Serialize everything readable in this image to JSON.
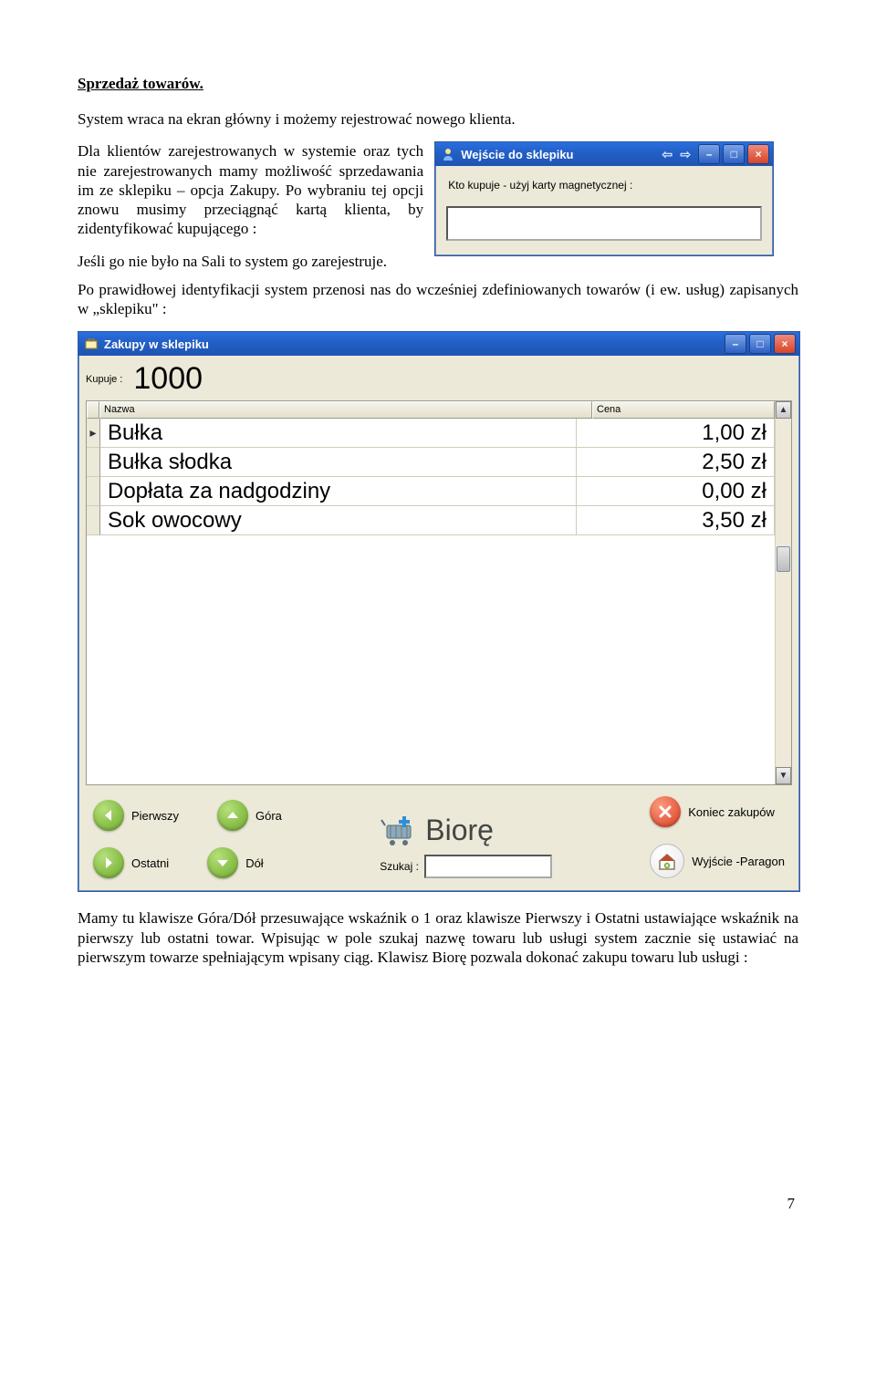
{
  "doc": {
    "heading": "Sprzedaż towarów.",
    "p1": "System wraca na ekran główny i możemy rejestrować nowego klienta.",
    "p2a": "Dla klientów zarejestrowanych w systemie oraz tych nie zarejestrowanych mamy możliwość sprzedawania im ze sklepiku – opcja Zakupy. Po wybraniu tej opcji znowu musimy przeciągnąć kartą klienta, by zidentyfikować kupującego :",
    "p2b": "Jeśli go nie było na Sali to system go zarejestruje.",
    "p3": "Po prawidłowej identyfikacji system przenosi nas do wcześniej zdefiniowanych towarów (i ew. usług) zapisanych w „sklepiku\" :",
    "p4": "Mamy tu klawisze Góra/Dół przesuwające wskaźnik o 1 oraz klawisze Pierwszy i Ostatni ustawiające wskaźnik na pierwszy lub ostatni towar. Wpisując w pole szukaj nazwę towaru lub usługi system zacznie się ustawiać na pierwszym towarze spełniającym wpisany ciąg. Klawisz Biorę pozwala dokonać zakupu towaru lub usługi :",
    "page_number": "7"
  },
  "dlg1": {
    "title": "Wejście do sklepiku",
    "label": "Kto kupuje - użyj karty magnetycznej :",
    "value": ""
  },
  "dlg2": {
    "title": "Zakupy w sklepiku",
    "buyer_label": "Kupuje :",
    "buyer_value": "1000",
    "col_name": "Nazwa",
    "col_price": "Cena",
    "rows": [
      {
        "name": "Bułka",
        "price": "1,00 zł"
      },
      {
        "name": "Bułka słodka",
        "price": "2,50 zł"
      },
      {
        "name": "Dopłata za nadgodziny",
        "price": "0,00 zł"
      },
      {
        "name": "Sok owocowy",
        "price": "3,50 zł"
      }
    ],
    "btn_first": "Pierwszy",
    "btn_last": "Ostatni",
    "btn_up": "Góra",
    "btn_down": "Dół",
    "btn_search_label": "Szukaj :",
    "btn_search_value": "",
    "btn_take": "Biorę",
    "btn_end": "Koniec zakupów",
    "btn_exit": "Wyjście -Paragon"
  }
}
